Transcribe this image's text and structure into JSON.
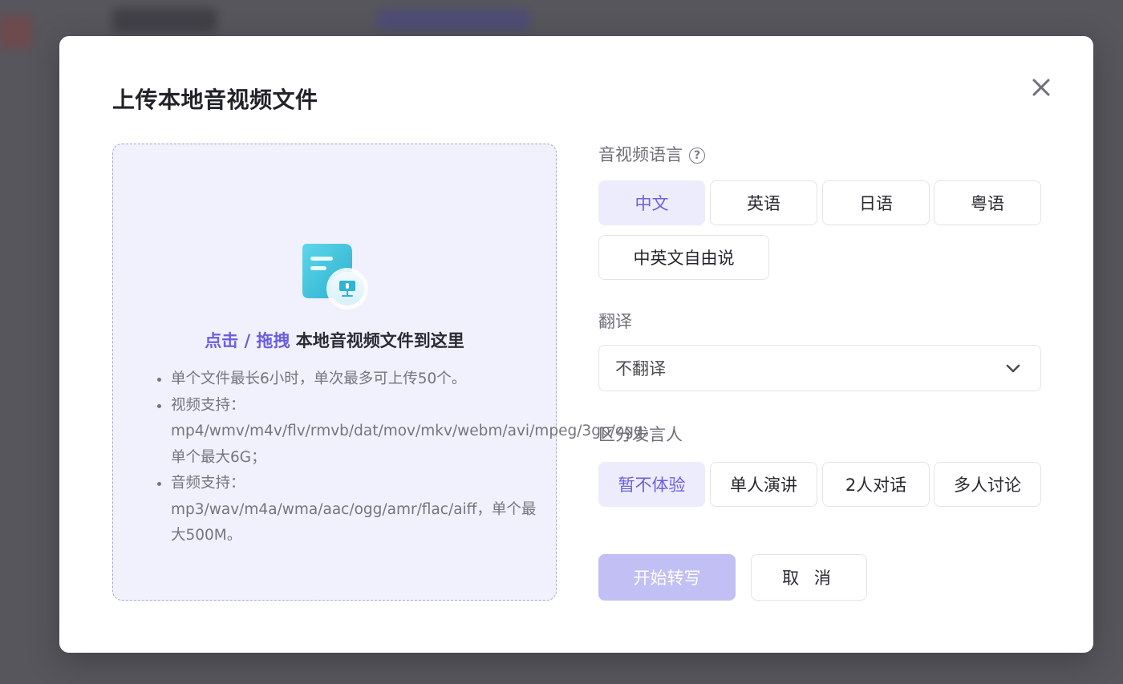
{
  "dialog": {
    "title": "上传本地音视频文件",
    "close_icon": "close-icon"
  },
  "upload": {
    "icon": "audio-file-icon",
    "action_text": "点击 / 拖拽",
    "target_text": " 本地音视频文件到这里",
    "rules": [
      "单个文件最长6小时，单次最多可上传50个。",
      "视频支持：mp4/wmv/m4v/flv/rmvb/dat/mov/mkv/webm/avi/mpeg/3gp/ogg，单个最大6G；",
      "音频支持：mp3/wav/m4a/wma/aac/ogg/amr/flac/aiff，单个最大500M。"
    ]
  },
  "language": {
    "label": "音视频语言",
    "help_icon": "question-circle-icon",
    "options": [
      "中文",
      "英语",
      "日语",
      "粤语",
      "中英文自由说"
    ],
    "selected": "中文"
  },
  "translation": {
    "label": "翻译",
    "value": "不翻译",
    "dropdown_icon": "chevron-down-icon"
  },
  "speakers": {
    "label": "区分发言人",
    "options": [
      "暂不体验",
      "单人演讲",
      "2人对话",
      "多人讨论"
    ],
    "selected": "暂不体验"
  },
  "actions": {
    "start_label": "开始转写",
    "cancel_label": "取 消"
  },
  "colors": {
    "accent": "#6b5fe0",
    "selected_bg": "#ececfc",
    "dropzone_bg": "#f1f1fd",
    "primary_disabled": "#c2bff5"
  }
}
